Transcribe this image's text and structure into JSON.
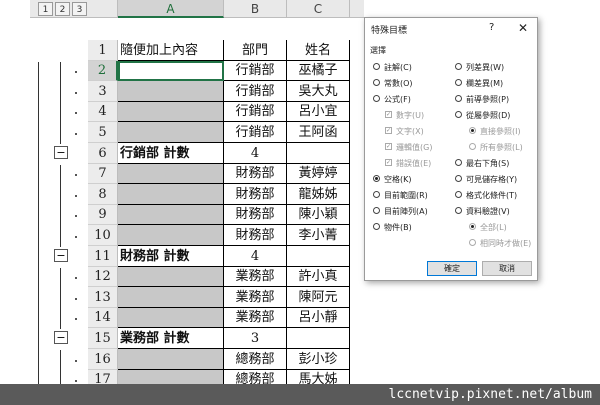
{
  "outline_levels": [
    "1",
    "2",
    "3"
  ],
  "columns": [
    "A",
    "B",
    "C"
  ],
  "rows": [
    {
      "num": "1",
      "a": "隨便加上內容",
      "b": "部門",
      "c": "姓名",
      "type": "header"
    },
    {
      "num": "2",
      "a": "",
      "b": "行銷部",
      "c": "巫橘子",
      "type": "data"
    },
    {
      "num": "3",
      "a": "",
      "b": "行銷部",
      "c": "吳大丸",
      "type": "data"
    },
    {
      "num": "4",
      "a": "",
      "b": "行銷部",
      "c": "呂小宜",
      "type": "data"
    },
    {
      "num": "5",
      "a": "",
      "b": "行銷部",
      "c": "王阿函",
      "type": "data"
    },
    {
      "num": "6",
      "a": "行銷部 計數",
      "b": "4",
      "c": "",
      "type": "subtotal"
    },
    {
      "num": "7",
      "a": "",
      "b": "財務部",
      "c": "黃婷婷",
      "type": "data"
    },
    {
      "num": "8",
      "a": "",
      "b": "財務部",
      "c": "龍姊姊",
      "type": "data"
    },
    {
      "num": "9",
      "a": "",
      "b": "財務部",
      "c": "陳小穎",
      "type": "data"
    },
    {
      "num": "10",
      "a": "",
      "b": "財務部",
      "c": "李小菁",
      "type": "data"
    },
    {
      "num": "11",
      "a": "財務部 計數",
      "b": "4",
      "c": "",
      "type": "subtotal"
    },
    {
      "num": "12",
      "a": "",
      "b": "業務部",
      "c": "許小真",
      "type": "data"
    },
    {
      "num": "13",
      "a": "",
      "b": "業務部",
      "c": "陳阿元",
      "type": "data"
    },
    {
      "num": "14",
      "a": "",
      "b": "業務部",
      "c": "呂小靜",
      "type": "data"
    },
    {
      "num": "15",
      "a": "業務部 計數",
      "b": "3",
      "c": "",
      "type": "subtotal"
    },
    {
      "num": "16",
      "a": "",
      "b": "總務部",
      "c": "彭小珍",
      "type": "data"
    },
    {
      "num": "17",
      "a": "",
      "b": "總務部",
      "c": "馬大姊",
      "type": "data"
    }
  ],
  "collapse_symbol": "−",
  "dialog": {
    "title": "特殊目標",
    "help": "?",
    "close": "✕",
    "section": "選擇",
    "left_options": [
      {
        "label": "註解(C)",
        "kind": "radio",
        "checked": false,
        "disabled": false
      },
      {
        "label": "常數(O)",
        "kind": "radio",
        "checked": false,
        "disabled": false
      },
      {
        "label": "公式(F)",
        "kind": "radio",
        "checked": false,
        "disabled": false
      },
      {
        "label": "數字(U)",
        "kind": "check",
        "checked": true,
        "disabled": true
      },
      {
        "label": "文字(X)",
        "kind": "check",
        "checked": true,
        "disabled": true
      },
      {
        "label": "邏輯值(G)",
        "kind": "check",
        "checked": true,
        "disabled": true
      },
      {
        "label": "錯誤值(E)",
        "kind": "check",
        "checked": true,
        "disabled": true
      },
      {
        "label": "空格(K)",
        "kind": "radio",
        "checked": true,
        "disabled": false
      },
      {
        "label": "目前範圍(R)",
        "kind": "radio",
        "checked": false,
        "disabled": false
      },
      {
        "label": "目前陣列(A)",
        "kind": "radio",
        "checked": false,
        "disabled": false
      },
      {
        "label": "物件(B)",
        "kind": "radio",
        "checked": false,
        "disabled": false
      }
    ],
    "right_options": [
      {
        "label": "列差異(W)",
        "kind": "radio",
        "checked": false,
        "disabled": false
      },
      {
        "label": "欄差異(M)",
        "kind": "radio",
        "checked": false,
        "disabled": false
      },
      {
        "label": "前導參照(P)",
        "kind": "radio",
        "checked": false,
        "disabled": false
      },
      {
        "label": "從屬參照(D)",
        "kind": "radio",
        "checked": false,
        "disabled": false
      },
      {
        "label": "直接參照(I)",
        "kind": "radio",
        "checked": true,
        "disabled": true
      },
      {
        "label": "所有參照(L)",
        "kind": "radio",
        "checked": false,
        "disabled": true
      },
      {
        "label": "最右下角(S)",
        "kind": "radio",
        "checked": false,
        "disabled": false
      },
      {
        "label": "可見儲存格(Y)",
        "kind": "radio",
        "checked": false,
        "disabled": false
      },
      {
        "label": "格式化條件(T)",
        "kind": "radio",
        "checked": false,
        "disabled": false
      },
      {
        "label": "資料驗證(V)",
        "kind": "radio",
        "checked": false,
        "disabled": false
      },
      {
        "label": "全部(L)",
        "kind": "radio",
        "checked": true,
        "disabled": true
      },
      {
        "label": "相同時才做(E)",
        "kind": "radio",
        "checked": false,
        "disabled": true
      }
    ],
    "ok_label": "確定",
    "cancel_label": "取消"
  },
  "footer_text": "lccnetvip.pixnet.net/album"
}
